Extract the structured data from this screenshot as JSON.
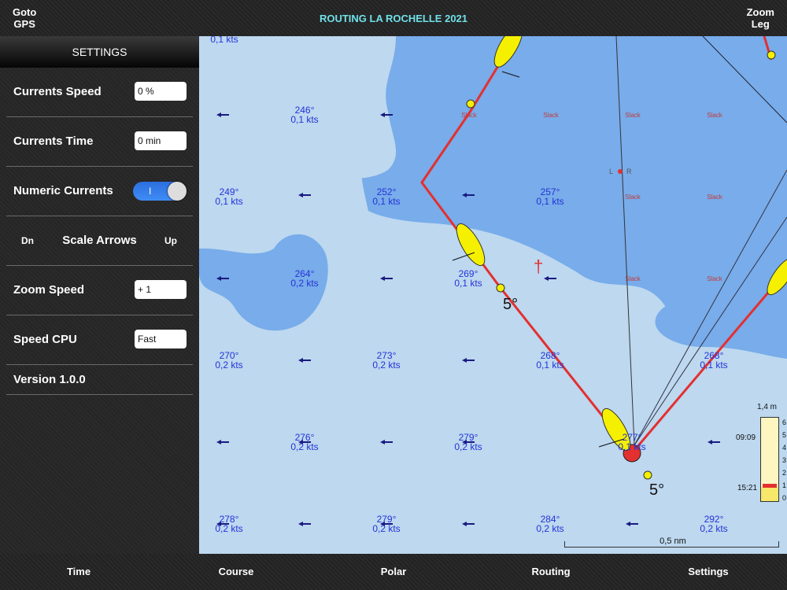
{
  "header": {
    "goto_gps_line1": "Goto",
    "goto_gps_line2": "GPS",
    "title": "ROUTING LA ROCHELLE 2021",
    "zoom_leg_line1": "Zoom",
    "zoom_leg_line2": "Leg"
  },
  "settings": {
    "title": "SETTINGS",
    "currents_speed_label": "Currents Speed",
    "currents_speed_value": "0 %",
    "currents_time_label": "Currents Time",
    "currents_time_value": "0 min",
    "numeric_currents_label": "Numeric Currents",
    "numeric_currents_on": true,
    "numeric_currents_glyph": "I",
    "scale_arrows_label": "Scale Arrows",
    "scale_dn": "Dn",
    "scale_up": "Up",
    "zoom_speed_label": "Zoom Speed",
    "zoom_speed_value": "+ 1",
    "speed_cpu_label": "Speed CPU",
    "speed_cpu_value": "Fast",
    "version_label": "Version 1.0.0"
  },
  "map": {
    "top_partial_label": "0,1 kts",
    "current_labels": [
      {
        "deg": "246°",
        "kts": "0,1 kts"
      },
      {
        "deg": "249°",
        "kts": "0,1 kts"
      },
      {
        "deg": "252°",
        "kts": "0,1 kts"
      },
      {
        "deg": "257°",
        "kts": "0,1 kts"
      },
      {
        "deg": "264°",
        "kts": "0,2 kts"
      },
      {
        "deg": "269°",
        "kts": "0,1 kts"
      },
      {
        "deg": "270°",
        "kts": "0,2 kts"
      },
      {
        "deg": "273°",
        "kts": "0,2 kts"
      },
      {
        "deg": "268°",
        "kts": "0,1 kts"
      },
      {
        "deg": "268°",
        "kts": "0,1 kts"
      },
      {
        "deg": "276°",
        "kts": "0,2 kts"
      },
      {
        "deg": "279°",
        "kts": "0,2 kts"
      },
      {
        "deg": "277°",
        "kts": "0,1 kts"
      },
      {
        "deg": "278°",
        "kts": "0,2 kts"
      },
      {
        "deg": "279°",
        "kts": "0,2 kts"
      },
      {
        "deg": "284°",
        "kts": "0,2 kts"
      },
      {
        "deg": "292°",
        "kts": "0,2 kts"
      }
    ],
    "slack_text": "Slack",
    "wind_angle_1": "5°",
    "wind_angle_2": "5°",
    "mark_left": "L",
    "mark_right": "R",
    "scale_label": "0,5 nm"
  },
  "tide": {
    "height_label": "1,4 m",
    "time_high": "09:09",
    "time_low": "15:21",
    "ticks": [
      "6",
      "5",
      "4",
      "3",
      "2",
      "1",
      "0"
    ],
    "level_fraction": 0.17
  },
  "tabs": {
    "time": "Time",
    "course": "Course",
    "polar": "Polar",
    "routing": "Routing",
    "settings": "Settings"
  },
  "colors": {
    "title": "#6fe0e8",
    "route": "#e33030",
    "current_text": "#2433d6",
    "boat": "#f5f000",
    "toggle_on": "#3a82f0"
  }
}
